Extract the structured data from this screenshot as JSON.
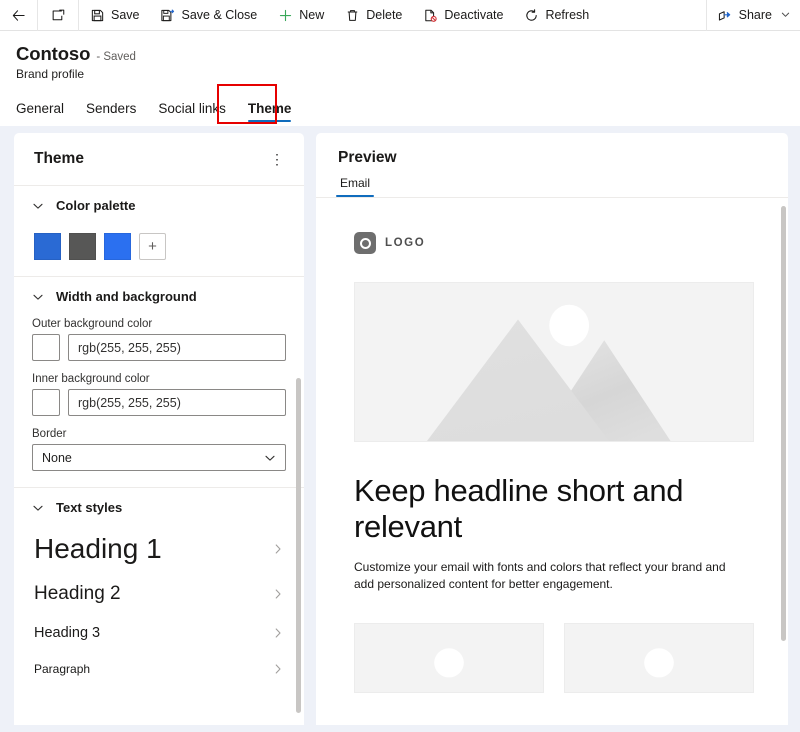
{
  "commandbar": {
    "back_label": "Back",
    "new_window_label": "Open in new window",
    "items": [
      {
        "id": "save",
        "label": "Save",
        "icon": "save-icon"
      },
      {
        "id": "save-close",
        "label": "Save & Close",
        "icon": "save-and-close-icon"
      },
      {
        "id": "new",
        "label": "New",
        "icon": "plus-icon"
      },
      {
        "id": "delete",
        "label": "Delete",
        "icon": "trash-icon"
      },
      {
        "id": "deactivate",
        "label": "Deactivate",
        "icon": "deactivate-icon"
      },
      {
        "id": "refresh",
        "label": "Refresh",
        "icon": "refresh-icon"
      }
    ],
    "share": {
      "label": "Share",
      "icon": "share-icon",
      "chevron": "⌄"
    }
  },
  "record": {
    "title": "Contoso",
    "save_state": "- Saved",
    "subtitle": "Brand profile"
  },
  "tabs": [
    {
      "id": "general",
      "label": "General",
      "active": false
    },
    {
      "id": "senders",
      "label": "Senders",
      "active": false
    },
    {
      "id": "social-links",
      "label": "Social links",
      "active": false
    },
    {
      "id": "theme",
      "label": "Theme",
      "active": true
    }
  ],
  "theme_panel": {
    "title": "Theme",
    "more_label": "⋮",
    "sections": {
      "color_palette": {
        "title": "Color palette",
        "swatches": [
          {
            "name": "palette-swatch-1",
            "color": "#2a6ad4"
          },
          {
            "name": "palette-swatch-2",
            "color": "#575756"
          },
          {
            "name": "palette-swatch-3",
            "color": "#2b70f0"
          }
        ],
        "add_label": "+"
      },
      "width_background": {
        "title": "Width and background",
        "fields": [
          {
            "id": "outer-background-color",
            "label": "Outer background color",
            "value": "rgb(255, 255, 255)",
            "placeholder": "rgb(255, 255, 255)",
            "chip_color": "#ffffff"
          },
          {
            "id": "inner-background-color",
            "label": "Inner background color",
            "value": "rgb(255, 255, 255)",
            "placeholder": "rgb(255, 255, 255)",
            "chip_color": "#ffffff"
          }
        ],
        "border": {
          "label": "Border",
          "value": "None",
          "options": [
            "None"
          ]
        }
      },
      "text_styles": {
        "title": "Text styles",
        "styles": [
          {
            "id": "heading-1",
            "label": "Heading 1"
          },
          {
            "id": "heading-2",
            "label": "Heading 2"
          },
          {
            "id": "heading-3",
            "label": "Heading 3"
          },
          {
            "id": "paragraph",
            "label": "Paragraph"
          }
        ]
      }
    }
  },
  "preview_panel": {
    "title": "Preview",
    "tabs": [
      {
        "id": "email",
        "label": "Email",
        "active": true
      }
    ],
    "email": {
      "logo_text": "LOGO",
      "headline": "Keep headline short and relevant",
      "body": "Customize your email with fonts and colors that reflect your brand and add personalized content for better engagement.",
      "hero_alt": "mountain-landscape-placeholder",
      "cards": [
        {
          "id": "card-1",
          "alt": "image-placeholder"
        },
        {
          "id": "card-2",
          "alt": "image-placeholder"
        }
      ]
    }
  },
  "colors": {
    "accent": "#0f6cbd",
    "page_background": "#eef1f8",
    "annotation": "#e60000",
    "placeholder_gray": "#f3f3f3"
  }
}
